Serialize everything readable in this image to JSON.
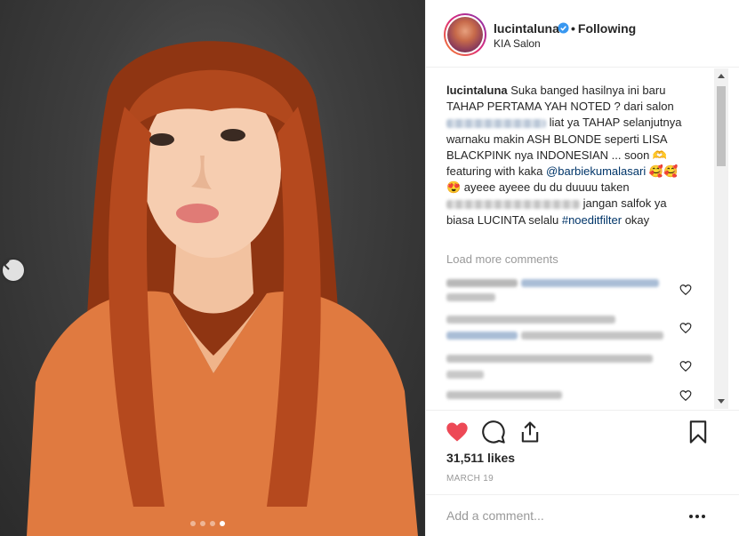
{
  "post": {
    "username": "lucintaluna",
    "verified": true,
    "following_label": "Following",
    "separator": "•",
    "location": "KIA Salon"
  },
  "caption": {
    "username": "lucintaluna",
    "part1": "Suka banged hasilnya ini baru TAHAP PERTAMA YAH NOTED ? dari salon",
    "part2": "liat ya TAHAP selanjutnya warnaku makin ASH BLONDE seperti LISA BLACKPINK nya INDONESIAN ... soon 🫶 featuring with kaka",
    "mention": "@barbiekumalasari",
    "part3": "🥰🥰😍 ayeee ayeee du du duuuu taken",
    "part4": "jangan salfok ya biasa LUCINTA selalu",
    "hashtag": "#noeditfilter",
    "part5": "okay"
  },
  "load_more_label": "Load more comments",
  "likes_text": "31,511 likes",
  "date_text": "MARCH 19",
  "add_comment_placeholder": "Add a comment...",
  "icons": {
    "like": "heart-filled-icon",
    "comment": "comment-icon",
    "share": "share-icon",
    "save": "bookmark-icon",
    "verified": "verified-badge-icon",
    "prev": "chevron-left-icon"
  },
  "carousel": {
    "total": 4,
    "active_index": 3
  },
  "colors": {
    "like_red": "#ed4956",
    "link_blue": "#003569",
    "muted": "#999999",
    "verified_blue": "#3897f0",
    "hair": "#a8441c",
    "top": "#e07a40"
  }
}
